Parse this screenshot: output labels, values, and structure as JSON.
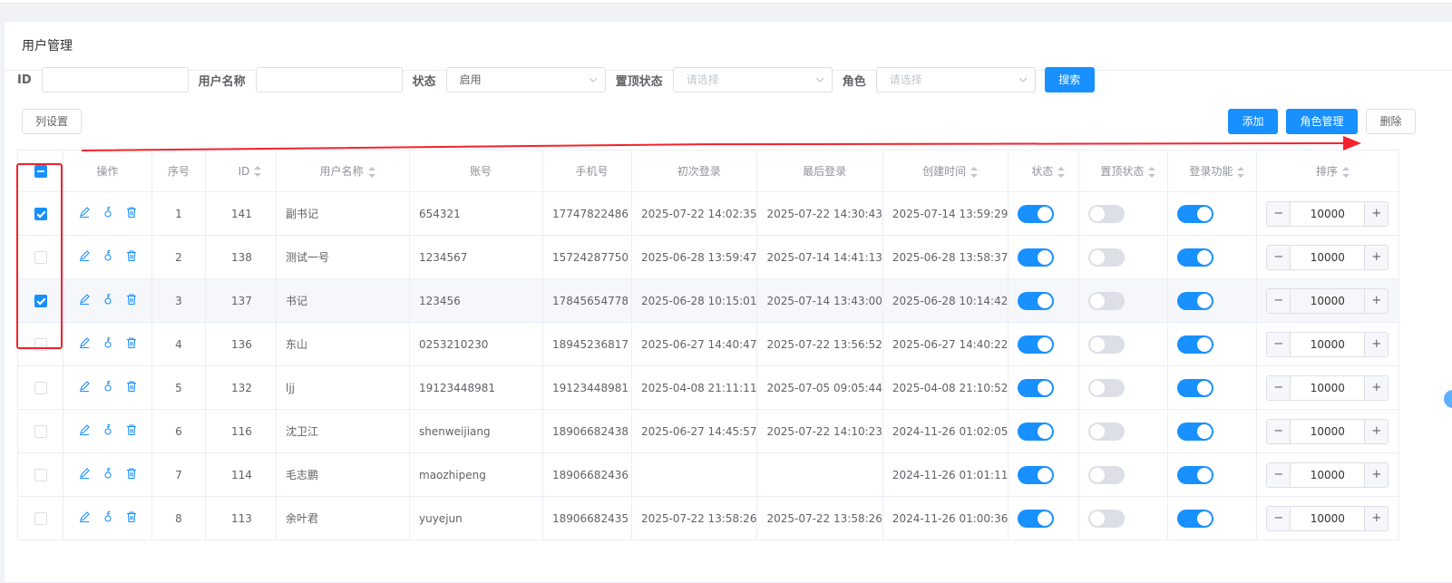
{
  "page_title": "用户管理",
  "filters": {
    "id_label": "ID",
    "id_value": "",
    "username_label": "用户名称",
    "username_value": "",
    "status_label": "状态",
    "status_value": "启用",
    "pin_label": "置顶状态",
    "pin_placeholder": "请选择",
    "role_label": "角色",
    "role_placeholder": "请选择",
    "search_label": "搜索"
  },
  "toolbar": {
    "column_settings_label": "列设置",
    "add_label": "添加",
    "role_manage_label": "角色管理",
    "delete_label": "删除"
  },
  "table": {
    "headers": {
      "ops": "操作",
      "seq": "序号",
      "id": "ID",
      "username": "用户名称",
      "account": "账号",
      "phone": "手机号",
      "first_login": "初次登录",
      "last_login": "最后登录",
      "created": "创建时间",
      "status": "状态",
      "pinned": "置顶状态",
      "login_enabled": "登录功能",
      "sort": "排序"
    },
    "header_checkbox": "indeterminate",
    "rows": [
      {
        "checked": true,
        "seq": "1",
        "id": "141",
        "username": "副书记",
        "account": "654321",
        "phone": "17747822486",
        "first_login": "2025-07-22 14:02:35",
        "last_login": "2025-07-22 14:30:43",
        "created": "2025-07-14 13:59:29",
        "status": true,
        "pinned": false,
        "login_enabled": true,
        "sort": "10000"
      },
      {
        "checked": false,
        "seq": "2",
        "id": "138",
        "username": "测试一号",
        "account": "1234567",
        "phone": "15724287750",
        "first_login": "2025-06-28 13:59:47",
        "last_login": "2025-07-14 14:41:13",
        "created": "2025-06-28 13:58:37",
        "status": true,
        "pinned": false,
        "login_enabled": true,
        "sort": "10000"
      },
      {
        "checked": true,
        "seq": "3",
        "id": "137",
        "username": "书记",
        "account": "123456",
        "phone": "17845654778",
        "first_login": "2025-06-28 10:15:01",
        "last_login": "2025-07-14 13:43:00",
        "created": "2025-06-28 10:14:42",
        "status": true,
        "pinned": false,
        "login_enabled": true,
        "sort": "10000"
      },
      {
        "checked": false,
        "seq": "4",
        "id": "136",
        "username": "东山",
        "account": "0253210230",
        "phone": "18945236817",
        "first_login": "2025-06-27 14:40:47",
        "last_login": "2025-07-22 13:56:52",
        "created": "2025-06-27 14:40:22",
        "status": true,
        "pinned": false,
        "login_enabled": true,
        "sort": "10000"
      },
      {
        "checked": false,
        "seq": "5",
        "id": "132",
        "username": "ljj",
        "account": "19123448981",
        "phone": "19123448981",
        "first_login": "2025-04-08 21:11:11",
        "last_login": "2025-07-05 09:05:44",
        "created": "2025-04-08 21:10:52",
        "status": true,
        "pinned": false,
        "login_enabled": true,
        "sort": "10000"
      },
      {
        "checked": false,
        "seq": "6",
        "id": "116",
        "username": "沈卫江",
        "account": "shenweijiang",
        "phone": "18906682438",
        "first_login": "2025-06-27 14:45:57",
        "last_login": "2025-07-22 14:10:23",
        "created": "2024-11-26 01:02:05",
        "status": true,
        "pinned": false,
        "login_enabled": true,
        "sort": "10000"
      },
      {
        "checked": false,
        "seq": "7",
        "id": "114",
        "username": "毛志鹏",
        "account": "maozhipeng",
        "phone": "18906682436",
        "first_login": "",
        "last_login": "",
        "created": "2024-11-26 01:01:11",
        "status": true,
        "pinned": false,
        "login_enabled": true,
        "sort": "10000"
      },
      {
        "checked": false,
        "seq": "8",
        "id": "113",
        "username": "余叶君",
        "account": "yuyejun",
        "phone": "18906682435",
        "first_login": "2025-07-22 13:58:26",
        "last_login": "2025-07-22 13:58:26",
        "created": "2024-11-26 01:00:36",
        "status": true,
        "pinned": false,
        "login_enabled": true,
        "sort": "10000"
      }
    ],
    "stepper": {
      "minus": "−",
      "plus": "+"
    }
  },
  "colors": {
    "primary": "#1890ff",
    "annotation_red": "#f5222d"
  },
  "icons": [
    "edit-icon",
    "role-assign-icon",
    "delete-icon",
    "chevron-down-icon"
  ]
}
